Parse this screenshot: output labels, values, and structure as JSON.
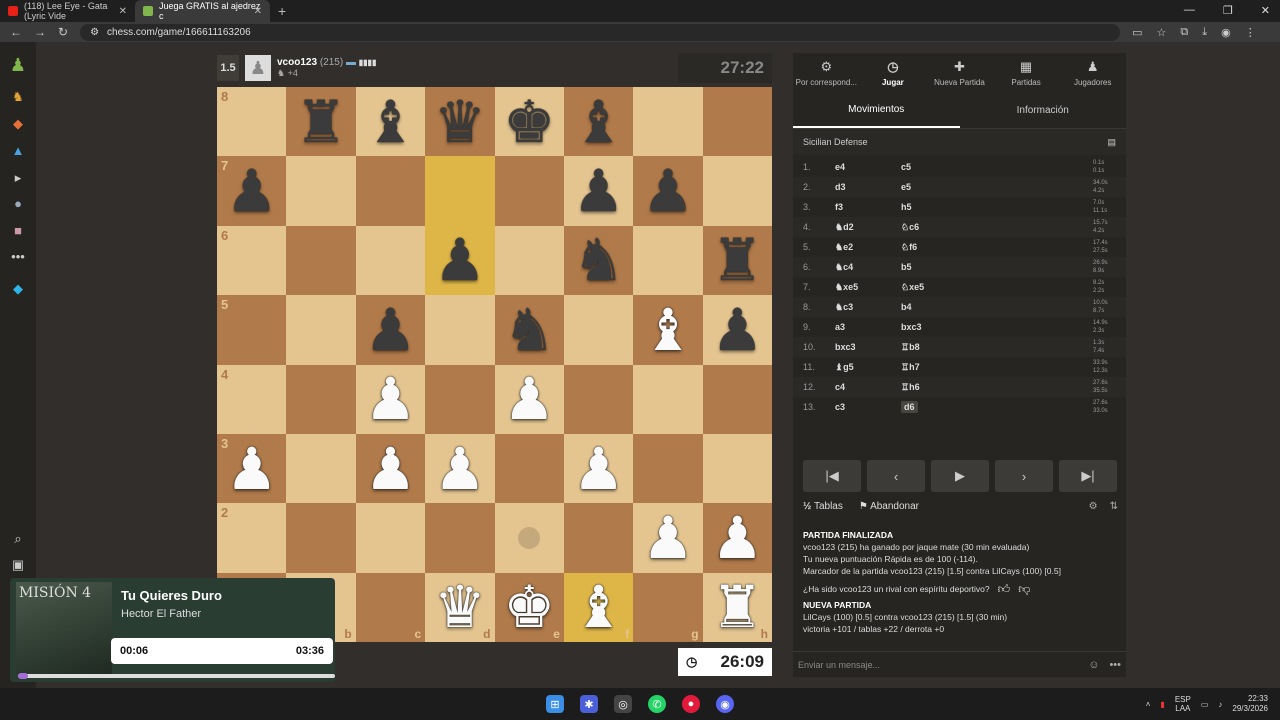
{
  "browser": {
    "tabs": [
      {
        "label": "(118) Lee Eye - Gata (Lyric Vide",
        "active": false
      },
      {
        "label": "Juega GRATIS al ajedrez c",
        "active": true
      }
    ],
    "url": "chess.com/game/166611163206"
  },
  "top_player": {
    "score": "1.5",
    "name": "vcoo123",
    "rating": "(215)",
    "captured": "+4",
    "clock": "27:22"
  },
  "bottom_clock": "26:09",
  "board": {
    "rows": [
      [
        "",
        "bR",
        "bB",
        "bQ",
        "bK",
        "bB",
        "",
        ""
      ],
      [
        "bP",
        "",
        "",
        "",
        "",
        "bP",
        "bP",
        ""
      ],
      [
        "",
        "",
        "",
        "bP",
        "",
        "bN",
        "",
        "bR"
      ],
      [
        "",
        "",
        "bP",
        "",
        "bN",
        "",
        "wB",
        "bP"
      ],
      [
        "",
        "",
        "wP",
        "",
        "wP",
        "",
        "",
        ""
      ],
      [
        "wP",
        "",
        "wP",
        "wP",
        "",
        "wP",
        "",
        ""
      ],
      [
        "",
        "",
        "",
        "",
        "",
        "",
        "wP",
        "wP"
      ],
      [
        "",
        "",
        "",
        "wQ",
        "wK",
        "wB",
        "",
        "wR"
      ]
    ],
    "ranks": [
      "8",
      "7",
      "6",
      "5",
      "4",
      "3",
      "2",
      "1"
    ],
    "files": [
      "a",
      "b",
      "c",
      "d",
      "e",
      "f",
      "g",
      "h"
    ],
    "highlight_squares": [
      "d7",
      "d6",
      "f1"
    ],
    "move_hint_square": "e2"
  },
  "panel": {
    "nav": [
      {
        "label": "Por correspond...",
        "icon": "gear-icon"
      },
      {
        "label": "Jugar",
        "icon": "clock-icon",
        "active": true
      },
      {
        "label": "Nueva Partida",
        "icon": "plus-icon"
      },
      {
        "label": "Partidas",
        "icon": "board-icon"
      },
      {
        "label": "Jugadores",
        "icon": "players-icon"
      }
    ],
    "subtabs": [
      "Movimientos",
      "Información"
    ],
    "opening": "Sicilian Defense",
    "moves": [
      {
        "n": "1.",
        "w": "e4",
        "b": "c5",
        "tw": "0.1s",
        "tb": "0.1s"
      },
      {
        "n": "2.",
        "w": "d3",
        "b": "e5",
        "tw": "34.0s",
        "tb": "4.2s"
      },
      {
        "n": "3.",
        "w": "f3",
        "b": "h5",
        "tw": "7.0s",
        "tb": "11.1s"
      },
      {
        "n": "4.",
        "w": "♞d2",
        "b": "♘c6",
        "tw": "15.7s",
        "tb": "4.2s"
      },
      {
        "n": "5.",
        "w": "♞e2",
        "b": "♘f6",
        "tw": "17.4s",
        "tb": "27.5s"
      },
      {
        "n": "6.",
        "w": "♞c4",
        "b": "b5",
        "tw": "26.9s",
        "tb": "8.9s"
      },
      {
        "n": "7.",
        "w": "♞xe5",
        "b": "♘xe5",
        "tw": "8.2s",
        "tb": "2.2s"
      },
      {
        "n": "8.",
        "w": "♞c3",
        "b": "b4",
        "tw": "10.0s",
        "tb": "8.7s"
      },
      {
        "n": "9.",
        "w": "a3",
        "b": "bxc3",
        "tw": "14.9s",
        "tb": "2.3s"
      },
      {
        "n": "10.",
        "w": "bxc3",
        "b": "♖b8",
        "tw": "1.3s",
        "tb": "7.4s"
      },
      {
        "n": "11.",
        "w": "♝g5",
        "b": "♖h7",
        "tw": "33.9s",
        "tb": "12.3s"
      },
      {
        "n": "12.",
        "w": "c4",
        "b": "♖h6",
        "tw": "27.6s",
        "tb": "35.5s"
      },
      {
        "n": "13.",
        "w": "c3",
        "b": "d6",
        "tw": "27.6s",
        "tb": "33.0s"
      }
    ],
    "actions": {
      "draw": "Tablas",
      "resign": "Abandonar"
    },
    "result": {
      "title": "PARTIDA FINALIZADA",
      "line1": "vcoo123 (215) ha ganado por jaque mate (30 min evaluada)",
      "line2": "Tu nueva puntuación Rápida es de 100 (-114).",
      "line3": "Marcador de la partida vcoo123 (215) [1.5] contra LilCays (100) [0.5]",
      "question": "¿Ha sido vcoo123 un rival con espíritu deportivo?",
      "new_title": "NUEVA PARTIDA",
      "new_line1": "LilCays (100) [0.5] contra vcoo123 (215) [1.5] (30 min)",
      "new_line2": "victoria +101 / tablas +22 / derrota +0"
    },
    "message_placeholder": "Enviar un mensaje..."
  },
  "media": {
    "title": "Tu Quieres Duro",
    "artist": "Hector El Father",
    "album_text": "MISIÓN 4",
    "elapsed": "00:06",
    "duration": "03:36",
    "progress_fraction": 0.03
  },
  "tray": {
    "lang1": "ESP",
    "lang2": "LAA",
    "time": "22:33",
    "date": "29/3/2026"
  }
}
